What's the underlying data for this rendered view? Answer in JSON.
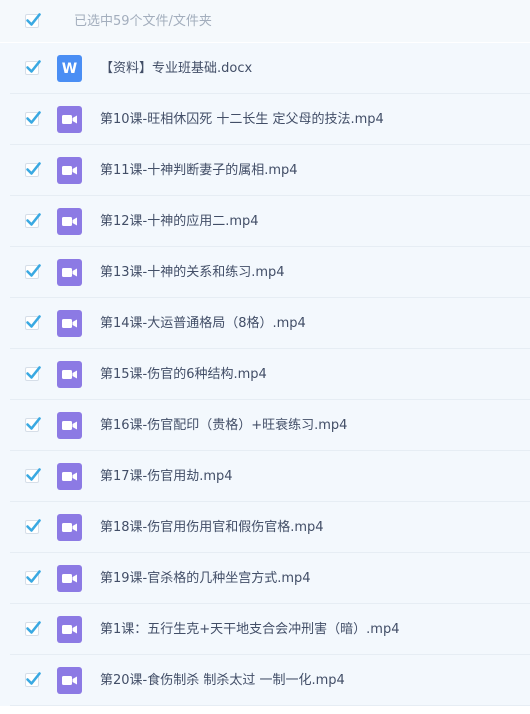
{
  "header": {
    "selection_text": "已选中59个文件/文件夹"
  },
  "files": [
    {
      "name": "【资料】专业班基础.docx",
      "type": "doc"
    },
    {
      "name": "第10课-旺相休囚死 十二长生 定父母的技法.mp4",
      "type": "video"
    },
    {
      "name": "第11课-十神判断妻子的属相.mp4",
      "type": "video"
    },
    {
      "name": "第12课-十神的应用二.mp4",
      "type": "video"
    },
    {
      "name": "第13课-十神的关系和练习.mp4",
      "type": "video"
    },
    {
      "name": "第14课-大运普通格局（8格）.mp4",
      "type": "video"
    },
    {
      "name": "第15课-伤官的6种结构.mp4",
      "type": "video"
    },
    {
      "name": "第16课-伤官配印（贵格）+旺衰练习.mp4",
      "type": "video"
    },
    {
      "name": "第17课-伤官用劫.mp4",
      "type": "video"
    },
    {
      "name": "第18课-伤官用伤用官和假伤官格.mp4",
      "type": "video"
    },
    {
      "name": "第19课-官杀格的几种坐宫方式.mp4",
      "type": "video"
    },
    {
      "name": "第1课：五行生克+天干地支合会冲刑害（暗）.mp4",
      "type": "video"
    },
    {
      "name": "第20课-食伤制杀 制杀太过 一制一化.mp4",
      "type": "video"
    }
  ],
  "icons": {
    "checkbox": "checkmark-icon",
    "video": "video-camera-icon",
    "doc": "word-document-icon"
  },
  "colors": {
    "check": "#3aa9e2",
    "video_icon": "#8c7ae4",
    "doc_icon": "#4a8ef4",
    "row_background": "#f3f8fd"
  }
}
